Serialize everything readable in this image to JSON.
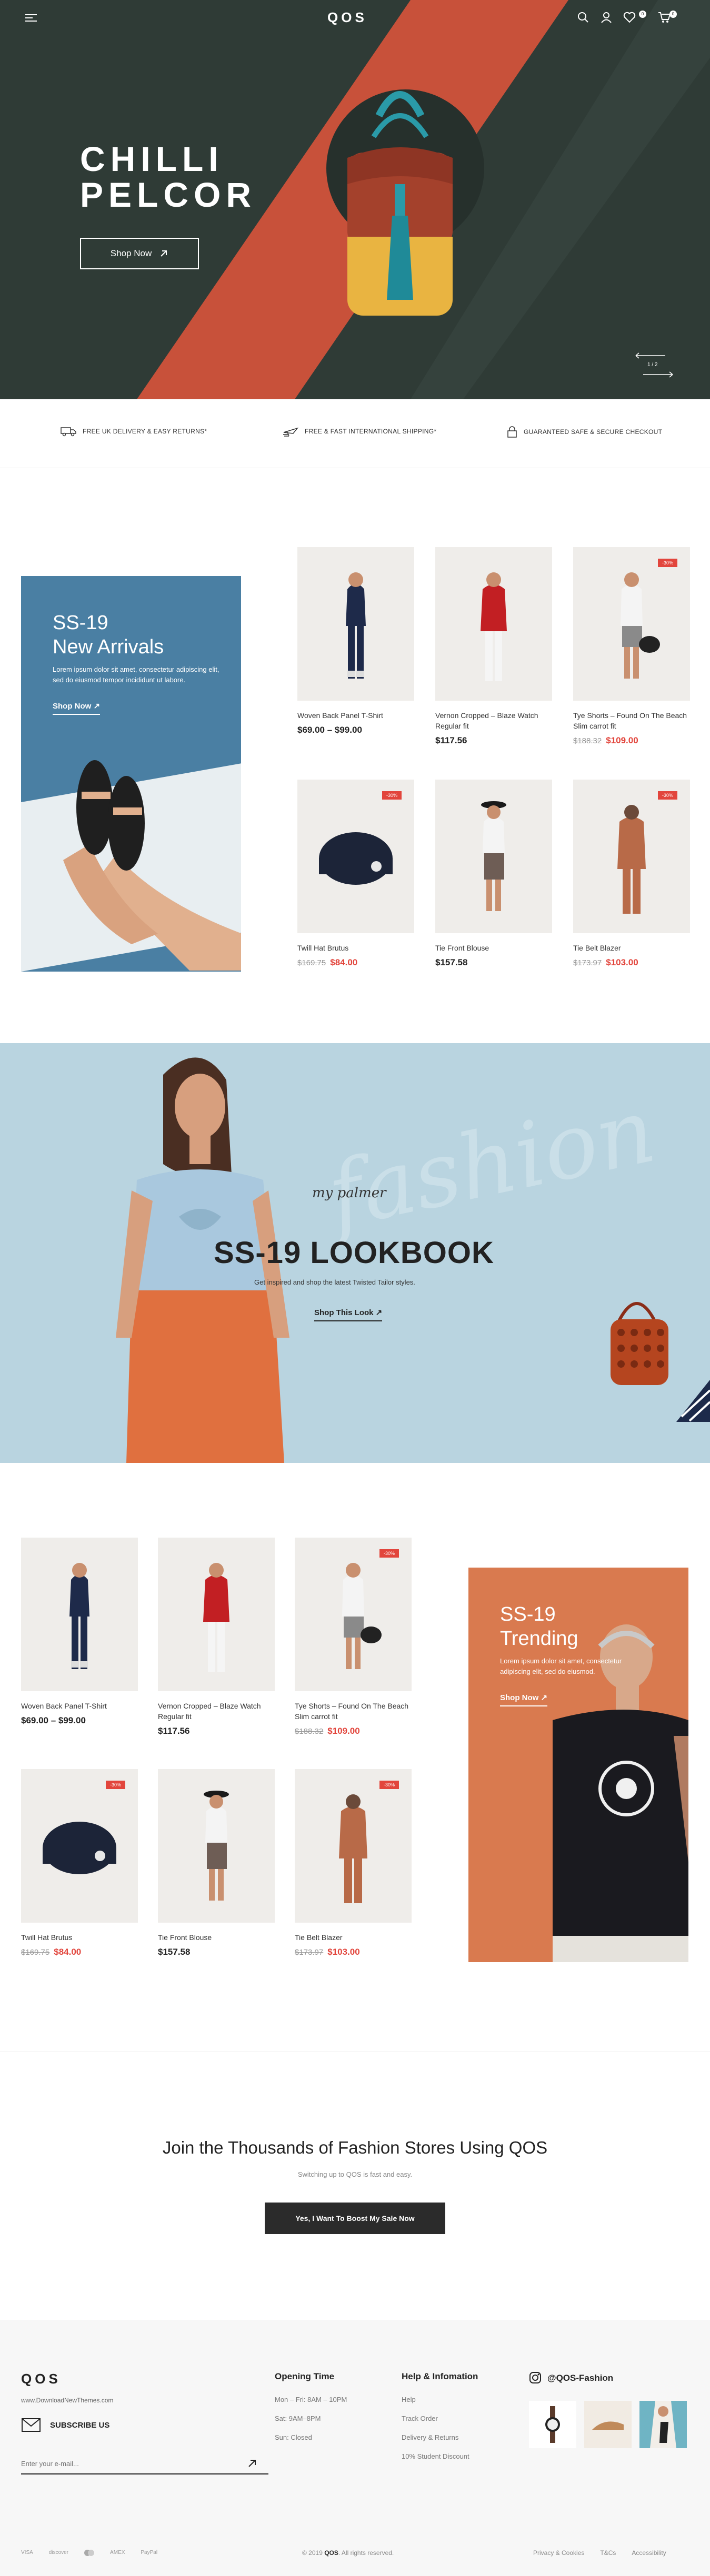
{
  "brand": "QOS",
  "header": {
    "cart_count": "0",
    "wish_count": "0"
  },
  "hero": {
    "title_line1": "CHILLI",
    "title_line2": "PELCOR",
    "button": "Shop Now",
    "slide_counter": "1 / 2"
  },
  "features": [
    {
      "icon": "truck-icon",
      "label": "FREE UK DELIVERY & EASY RETURNS*"
    },
    {
      "icon": "plane-icon",
      "label": "FREE & FAST INTERNATIONAL SHIPPING*"
    },
    {
      "icon": "lock-icon",
      "label": "GUARANTEED SAFE & SECURE CHECKOUT"
    }
  ],
  "promo1": {
    "title_line1": "SS-19",
    "title_line2": "New Arrivals",
    "text": "Lorem ipsum dolor sit amet, consectetur adipiscing elit, sed do eiusmod tempor incididunt ut labore.",
    "link": "Shop Now"
  },
  "products": [
    {
      "name": "Woven Back Panel T-Shirt",
      "price": "$69.00 – $99.00",
      "old_price": "",
      "sale": false
    },
    {
      "name": "Vernon Cropped – Blaze Watch Regular fit",
      "price": "$117.56",
      "old_price": "",
      "sale": false
    },
    {
      "name": "Tye Shorts – Found On The Beach Slim carrot fit",
      "price": "$109.00",
      "old_price": "$188.32",
      "sale": true
    },
    {
      "name": "Twill Hat Brutus",
      "price": "$84.00",
      "old_price": "$169.75",
      "sale": true
    },
    {
      "name": "Tie Front Blouse",
      "price": "$157.58",
      "old_price": "",
      "sale": false
    },
    {
      "name": "Tie Belt Blazer",
      "price": "$103.00",
      "old_price": "$173.97",
      "sale": true
    }
  ],
  "badge_text": "-30%",
  "lookbook": {
    "signature": "my palmer",
    "title": "SS-19 LOOKBOOK",
    "subtitle": "Get inspired and shop the latest Twisted Tailor styles.",
    "link": "Shop This Look",
    "watermark": "fashion"
  },
  "promo2": {
    "title_line1": "SS-19",
    "title_line2": "Trending",
    "text": "Lorem ipsum dolor sit amet, consectetur adipiscing elit, sed do eiusmod.",
    "link": "Shop Now"
  },
  "join": {
    "title": "Join the Thousands of Fashion Stores Using QOS",
    "subtitle": "Switching up to QOS is fast and easy.",
    "button": "Yes, I Want To Boost My Sale Now"
  },
  "footer": {
    "site": "www.DownloadNewThemes.com",
    "subscribe": "SUBSCRIBE US",
    "email_placeholder": "Enter your e-mail...",
    "opening_title": "Opening Time",
    "opening": [
      "Mon – Fri: 8AM – 10PM",
      "Sat: 9AM–8PM",
      "Sun: Closed"
    ],
    "help_title": "Help & Infomation",
    "help": [
      "Help",
      "Track Order",
      "Delivery & Returns",
      "10% Student Discount"
    ],
    "instagram": "@QOS-Fashion",
    "payments": [
      "VISA",
      "discover",
      "mastercard",
      "AMEX",
      "PayPal"
    ],
    "copyright_prefix": "© 2019",
    "copyright_brand": "QOS",
    "copyright_suffix": ". All rights reserved.",
    "links": [
      "Privacy & Cookies",
      "T&Cs",
      "Accessibility"
    ]
  },
  "colors": {
    "hero_bg": "#2f3b36",
    "hero_stripe": "#c8513a",
    "promo1_bg": "#4a7fa3",
    "lookbook_bg": "#b9d4e0",
    "promo2_bg": "#d97a4f",
    "sale": "#e2453c",
    "dark_button": "#2b2b2b"
  }
}
